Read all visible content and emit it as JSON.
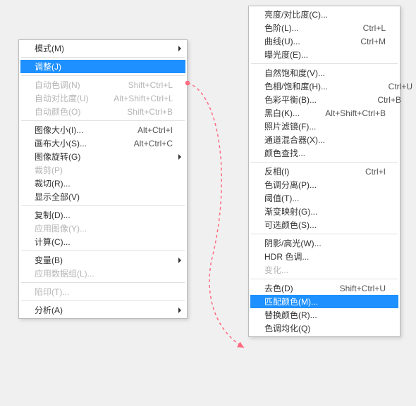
{
  "left_menu": {
    "groups": [
      [
        {
          "label": "模式(M)",
          "shortcut": "",
          "arrow": true,
          "disabled": false,
          "highlight": false
        }
      ],
      [
        {
          "label": "调整(J)",
          "shortcut": "",
          "arrow": false,
          "disabled": false,
          "highlight": true
        }
      ],
      [
        {
          "label": "自动色调(N)",
          "shortcut": "Shift+Ctrl+L",
          "arrow": false,
          "disabled": true,
          "highlight": false
        },
        {
          "label": "自动对比度(U)",
          "shortcut": "Alt+Shift+Ctrl+L",
          "arrow": false,
          "disabled": true,
          "highlight": false
        },
        {
          "label": "自动颜色(O)",
          "shortcut": "Shift+Ctrl+B",
          "arrow": false,
          "disabled": true,
          "highlight": false
        }
      ],
      [
        {
          "label": "图像大小(I)...",
          "shortcut": "Alt+Ctrl+I",
          "arrow": false,
          "disabled": false,
          "highlight": false
        },
        {
          "label": "画布大小(S)...",
          "shortcut": "Alt+Ctrl+C",
          "arrow": false,
          "disabled": false,
          "highlight": false
        },
        {
          "label": "图像旋转(G)",
          "shortcut": "",
          "arrow": true,
          "disabled": false,
          "highlight": false
        },
        {
          "label": "裁剪(P)",
          "shortcut": "",
          "arrow": false,
          "disabled": true,
          "highlight": false
        },
        {
          "label": "裁切(R)...",
          "shortcut": "",
          "arrow": false,
          "disabled": false,
          "highlight": false
        },
        {
          "label": "显示全部(V)",
          "shortcut": "",
          "arrow": false,
          "disabled": false,
          "highlight": false
        }
      ],
      [
        {
          "label": "复制(D)...",
          "shortcut": "",
          "arrow": false,
          "disabled": false,
          "highlight": false
        },
        {
          "label": "应用图像(Y)...",
          "shortcut": "",
          "arrow": false,
          "disabled": true,
          "highlight": false
        },
        {
          "label": "计算(C)...",
          "shortcut": "",
          "arrow": false,
          "disabled": false,
          "highlight": false
        }
      ],
      [
        {
          "label": "变量(B)",
          "shortcut": "",
          "arrow": true,
          "disabled": false,
          "highlight": false
        },
        {
          "label": "应用数据组(L)...",
          "shortcut": "",
          "arrow": false,
          "disabled": true,
          "highlight": false
        }
      ],
      [
        {
          "label": "陷印(T)...",
          "shortcut": "",
          "arrow": false,
          "disabled": true,
          "highlight": false
        }
      ],
      [
        {
          "label": "分析(A)",
          "shortcut": "",
          "arrow": true,
          "disabled": false,
          "highlight": false
        }
      ]
    ]
  },
  "right_menu": {
    "groups": [
      [
        {
          "label": "亮度/对比度(C)...",
          "shortcut": "",
          "arrow": false,
          "disabled": false,
          "highlight": false
        },
        {
          "label": "色阶(L)...",
          "shortcut": "Ctrl+L",
          "arrow": false,
          "disabled": false,
          "highlight": false
        },
        {
          "label": "曲线(U)...",
          "shortcut": "Ctrl+M",
          "arrow": false,
          "disabled": false,
          "highlight": false
        },
        {
          "label": "曝光度(E)...",
          "shortcut": "",
          "arrow": false,
          "disabled": false,
          "highlight": false
        }
      ],
      [
        {
          "label": "自然饱和度(V)...",
          "shortcut": "",
          "arrow": false,
          "disabled": false,
          "highlight": false
        },
        {
          "label": "色相/饱和度(H)...",
          "shortcut": "Ctrl+U",
          "arrow": false,
          "disabled": false,
          "highlight": false
        },
        {
          "label": "色彩平衡(B)...",
          "shortcut": "Ctrl+B",
          "arrow": false,
          "disabled": false,
          "highlight": false
        },
        {
          "label": "黑白(K)...",
          "shortcut": "Alt+Shift+Ctrl+B",
          "arrow": false,
          "disabled": false,
          "highlight": false
        },
        {
          "label": "照片滤镜(F)...",
          "shortcut": "",
          "arrow": false,
          "disabled": false,
          "highlight": false
        },
        {
          "label": "通道混合器(X)...",
          "shortcut": "",
          "arrow": false,
          "disabled": false,
          "highlight": false
        },
        {
          "label": "颜色查找...",
          "shortcut": "",
          "arrow": false,
          "disabled": false,
          "highlight": false
        }
      ],
      [
        {
          "label": "反相(I)",
          "shortcut": "Ctrl+I",
          "arrow": false,
          "disabled": false,
          "highlight": false
        },
        {
          "label": "色调分离(P)...",
          "shortcut": "",
          "arrow": false,
          "disabled": false,
          "highlight": false
        },
        {
          "label": "阈值(T)...",
          "shortcut": "",
          "arrow": false,
          "disabled": false,
          "highlight": false
        },
        {
          "label": "渐变映射(G)...",
          "shortcut": "",
          "arrow": false,
          "disabled": false,
          "highlight": false
        },
        {
          "label": "可选颜色(S)...",
          "shortcut": "",
          "arrow": false,
          "disabled": false,
          "highlight": false
        }
      ],
      [
        {
          "label": "阴影/高光(W)...",
          "shortcut": "",
          "arrow": false,
          "disabled": false,
          "highlight": false
        },
        {
          "label": "HDR 色调...",
          "shortcut": "",
          "arrow": false,
          "disabled": false,
          "highlight": false
        },
        {
          "label": "变化...",
          "shortcut": "",
          "arrow": false,
          "disabled": true,
          "highlight": false
        }
      ],
      [
        {
          "label": "去色(D)",
          "shortcut": "Shift+Ctrl+U",
          "arrow": false,
          "disabled": false,
          "highlight": false
        },
        {
          "label": "匹配颜色(M)...",
          "shortcut": "",
          "arrow": false,
          "disabled": false,
          "highlight": true
        },
        {
          "label": "替换颜色(R)...",
          "shortcut": "",
          "arrow": false,
          "disabled": false,
          "highlight": false
        },
        {
          "label": "色调均化(Q)",
          "shortcut": "",
          "arrow": false,
          "disabled": false,
          "highlight": false
        }
      ]
    ]
  }
}
